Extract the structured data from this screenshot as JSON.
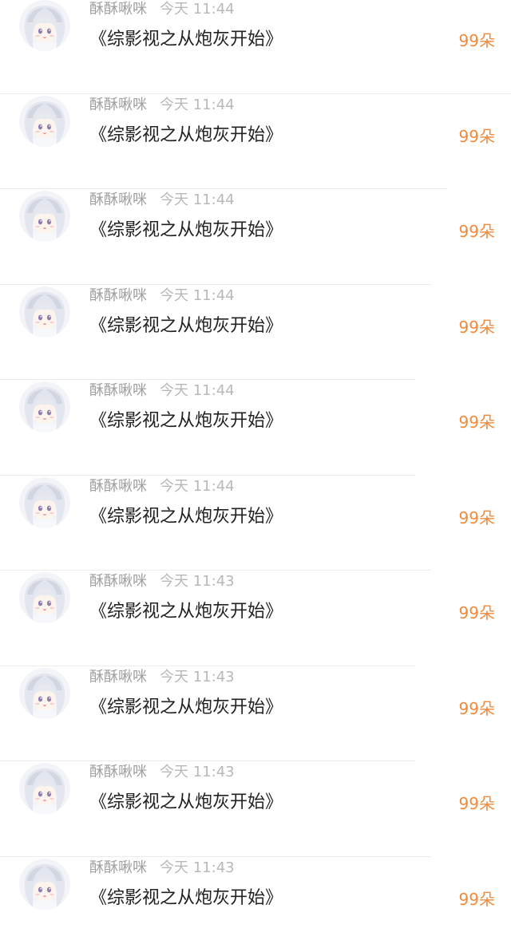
{
  "records": [
    {
      "username": "酥酥啾咪",
      "time": "今天 11:44",
      "message": "《综影视之从炮灰开始》",
      "gift": "99朵"
    },
    {
      "username": "酥酥啾咪",
      "time": "今天 11:44",
      "message": "《综影视之从炮灰开始》",
      "gift": "99朵"
    },
    {
      "username": "酥酥啾咪",
      "time": "今天 11:44",
      "message": "《综影视之从炮灰开始》",
      "gift": "99朵"
    },
    {
      "username": "酥酥啾咪",
      "time": "今天 11:44",
      "message": "《综影视之从炮灰开始》",
      "gift": "99朵"
    },
    {
      "username": "酥酥啾咪",
      "time": "今天 11:44",
      "message": "《综影视之从炮灰开始》",
      "gift": "99朵"
    },
    {
      "username": "酥酥啾咪",
      "time": "今天 11:44",
      "message": "《综影视之从炮灰开始》",
      "gift": "99朵"
    },
    {
      "username": "酥酥啾咪",
      "time": "今天 11:43",
      "message": "《综影视之从炮灰开始》",
      "gift": "99朵"
    },
    {
      "username": "酥酥啾咪",
      "time": "今天 11:43",
      "message": "《综影视之从炮灰开始》",
      "gift": "99朵"
    },
    {
      "username": "酥酥啾咪",
      "time": "今天 11:43",
      "message": "《综影视之从炮灰开始》",
      "gift": "99朵"
    },
    {
      "username": "酥酥啾咪",
      "time": "今天 11:43",
      "message": "《综影视之从炮灰开始》",
      "gift": "99朵"
    }
  ],
  "avatar_icon": "anime-girl-avatar-icon",
  "colors": {
    "username": "#a0a0a0",
    "time": "#b8b8b8",
    "message": "#222222",
    "gift": "#f08a3c",
    "divider": "#ececec"
  }
}
